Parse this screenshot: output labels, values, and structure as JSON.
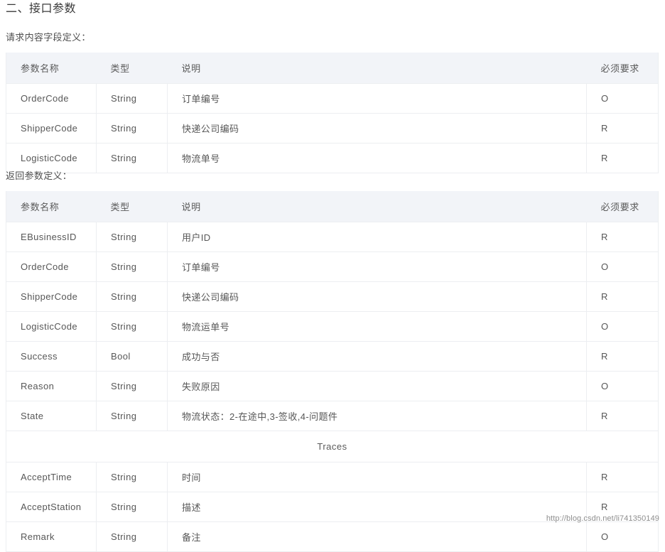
{
  "heading": "二、接口参数",
  "request_section": {
    "intro": "请求内容字段定义：",
    "columns": {
      "name": "参数名称",
      "type": "类型",
      "desc": "说明",
      "required": "必须要求"
    },
    "rows": [
      {
        "name": "OrderCode",
        "type": "String",
        "desc": "订单编号",
        "required": "O"
      },
      {
        "name": "ShipperCode",
        "type": "String",
        "desc": "快递公司编码",
        "required": "R"
      },
      {
        "name": "LogisticCode",
        "type": "String",
        "desc": "物流单号",
        "required": "R"
      }
    ]
  },
  "response_section": {
    "intro": "返回参数定义：",
    "columns": {
      "name": "参数名称",
      "type": "类型",
      "desc": "说明",
      "required": "必须要求"
    },
    "rows": [
      {
        "name": "EBusinessID",
        "type": "String",
        "desc": "用户ID",
        "required": "R"
      },
      {
        "name": "OrderCode",
        "type": "String",
        "desc": "订单编号",
        "required": "O"
      },
      {
        "name": "ShipperCode",
        "type": "String",
        "desc": "快递公司编码",
        "required": "R"
      },
      {
        "name": "LogisticCode",
        "type": "String",
        "desc": "物流运单号",
        "required": "O"
      },
      {
        "name": "Success",
        "type": "Bool",
        "desc": "成功与否",
        "required": "R"
      },
      {
        "name": "Reason",
        "type": "String",
        "desc": "失败原因",
        "required": "O"
      },
      {
        "name": "State",
        "type": "String",
        "desc": "物流状态：2-在途中,3-签收,4-问题件",
        "required": "R"
      }
    ],
    "group_label": "Traces",
    "trace_rows": [
      {
        "name": "AcceptTime",
        "type": "String",
        "desc": "时间",
        "required": "R"
      },
      {
        "name": "AcceptStation",
        "type": "String",
        "desc": "描述",
        "required": "R"
      },
      {
        "name": "Remark",
        "type": "String",
        "desc": "备注",
        "required": "O"
      }
    ]
  },
  "watermark": "http://blog.csdn.net/li741350149",
  "colors": {
    "header_bg": "#f2f4f8",
    "border": "#eceef1",
    "text": "#575757",
    "watermark_text": "#8e8e8e"
  }
}
